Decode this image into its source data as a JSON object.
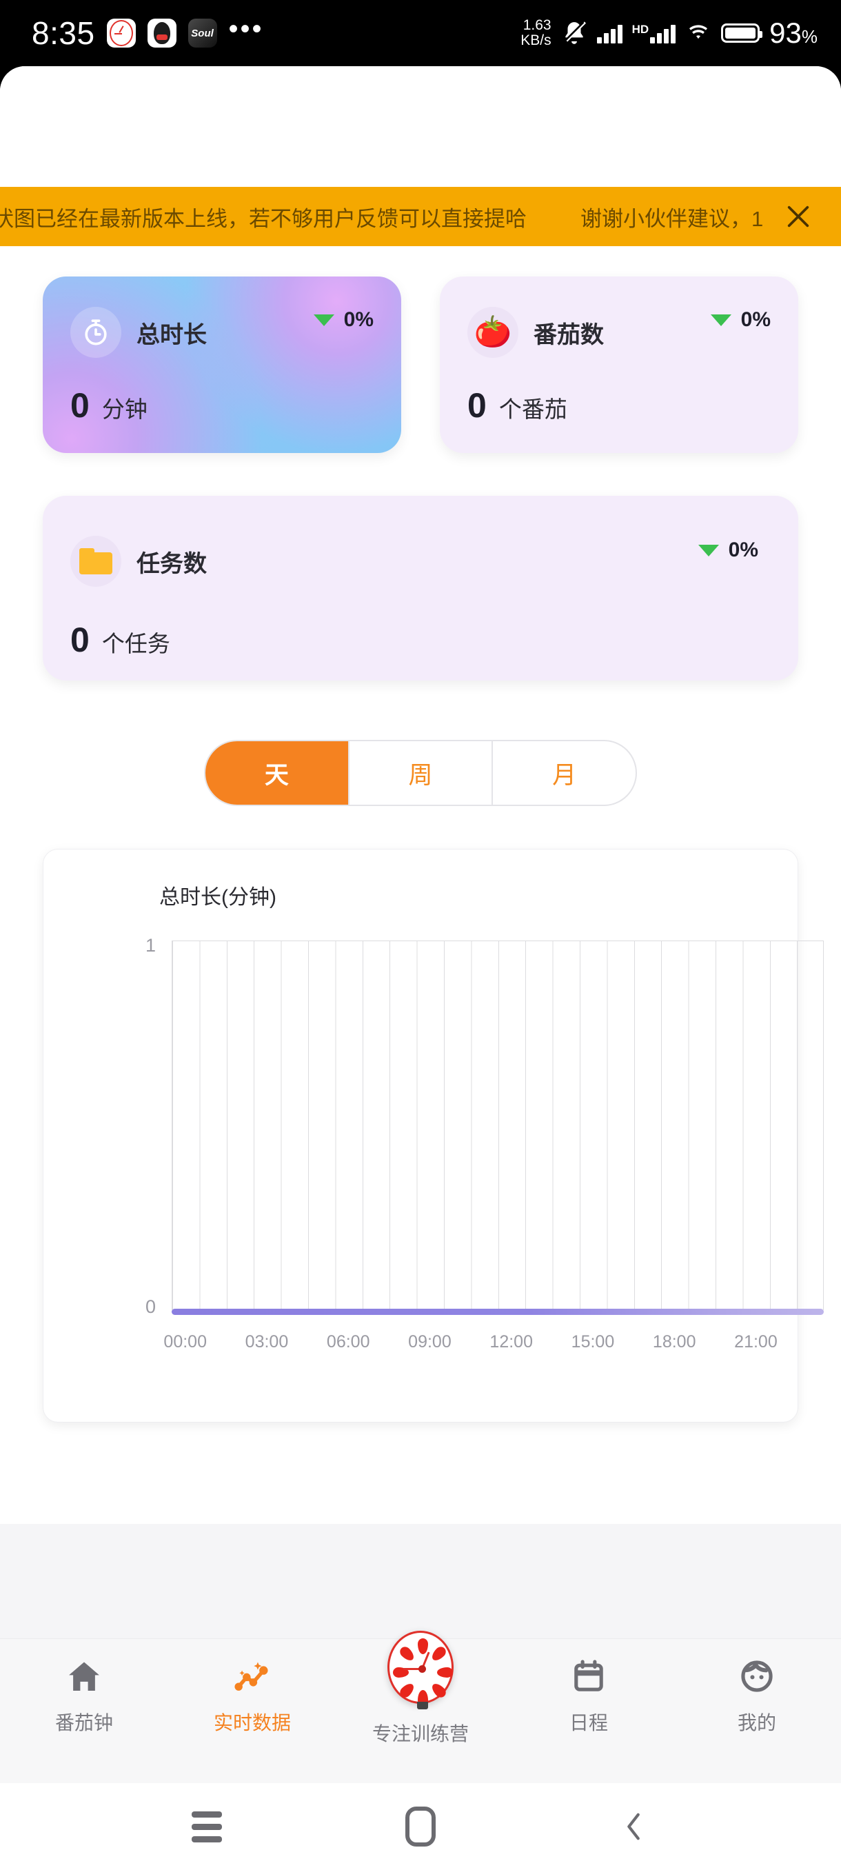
{
  "status_bar": {
    "time": "8:35",
    "app_icons": [
      "tomato-clock-app-icon",
      "qq-app-icon",
      "soul-app-icon"
    ],
    "soul_label": "Soul",
    "overflow": "•••",
    "net_speed_value": "1.63",
    "net_speed_unit": "KB/s",
    "mute_icon": "bell-muted-icon",
    "signal_icon": "signal-bars-icon",
    "volte_label": "HD",
    "wifi_icon": "wifi-icon",
    "battery_icon": "battery-icon",
    "battery_percent": "93",
    "battery_percent_symbol": "%"
  },
  "banner": {
    "message": "饼状图已经在最新版本上线，若不够用户反馈可以直接提哈",
    "message_secondary": "谢谢小伙伴建议，1",
    "close_label": "×",
    "background": "#F5A800",
    "text_color": "#6b4a00"
  },
  "stats": {
    "cards": [
      {
        "id": "total-duration",
        "icon": "stopwatch-icon",
        "title": "总时长",
        "value": "0",
        "unit": "分钟",
        "delta": "0%",
        "delta_direction": "down",
        "delta_color": "#3bbf4f",
        "style": "gradient"
      },
      {
        "id": "tomato-count",
        "icon": "tomato-icon",
        "icon_glyph": "🍅",
        "title": "番茄数",
        "value": "0",
        "unit": "个番茄",
        "delta": "0%",
        "delta_direction": "down",
        "delta_color": "#3bbf4f",
        "style": "plain"
      },
      {
        "id": "task-count",
        "icon": "folder-icon",
        "title": "任务数",
        "value": "0",
        "unit": "个任务",
        "delta": "0%",
        "delta_direction": "down",
        "delta_color": "#3bbf4f",
        "style": "plain"
      }
    ]
  },
  "range_tabs": {
    "options": [
      "天",
      "周",
      "月"
    ],
    "selected": "天",
    "active_color": "#F58220"
  },
  "chart_data": {
    "type": "line",
    "title": "总时长(分钟)",
    "xlabel": "",
    "ylabel": "分钟",
    "ylim": [
      0,
      1
    ],
    "ytick_labels": [
      "0",
      "1"
    ],
    "grid": true,
    "legend": false,
    "x_tick_labels": [
      "00:00",
      "03:00",
      "06:00",
      "09:00",
      "12:00",
      "15:00",
      "18:00",
      "21:00"
    ],
    "x": [
      "00:00",
      "01:00",
      "02:00",
      "03:00",
      "04:00",
      "05:00",
      "06:00",
      "07:00",
      "08:00",
      "09:00",
      "10:00",
      "11:00",
      "12:00",
      "13:00",
      "14:00",
      "15:00",
      "16:00",
      "17:00",
      "18:00",
      "19:00",
      "20:00",
      "21:00",
      "22:00",
      "23:00"
    ],
    "series": [
      {
        "name": "总时长(分钟)",
        "color": "#8a7ee0",
        "values": [
          0,
          0,
          0,
          0,
          0,
          0,
          0,
          0,
          0,
          0,
          0,
          0,
          0,
          0,
          0,
          0,
          0,
          0,
          0,
          0,
          0,
          0,
          0,
          0
        ]
      }
    ]
  },
  "bottom_nav": {
    "items": [
      {
        "id": "pomodoro",
        "icon": "home-icon",
        "label": "番茄钟",
        "active": false
      },
      {
        "id": "realtime-data",
        "icon": "chart-sparkle-icon",
        "label": "实时数据",
        "active": true
      },
      {
        "id": "focus-camp",
        "icon": "tomato-clock-icon",
        "label": "专注训练营",
        "active": false
      },
      {
        "id": "schedule",
        "icon": "calendar-icon",
        "label": "日程",
        "active": false
      },
      {
        "id": "mine",
        "icon": "person-icon",
        "label": "我的",
        "active": false
      }
    ]
  },
  "android_nav": {
    "recents": "recents-icon",
    "home": "home-nav-icon",
    "back": "back-icon"
  }
}
